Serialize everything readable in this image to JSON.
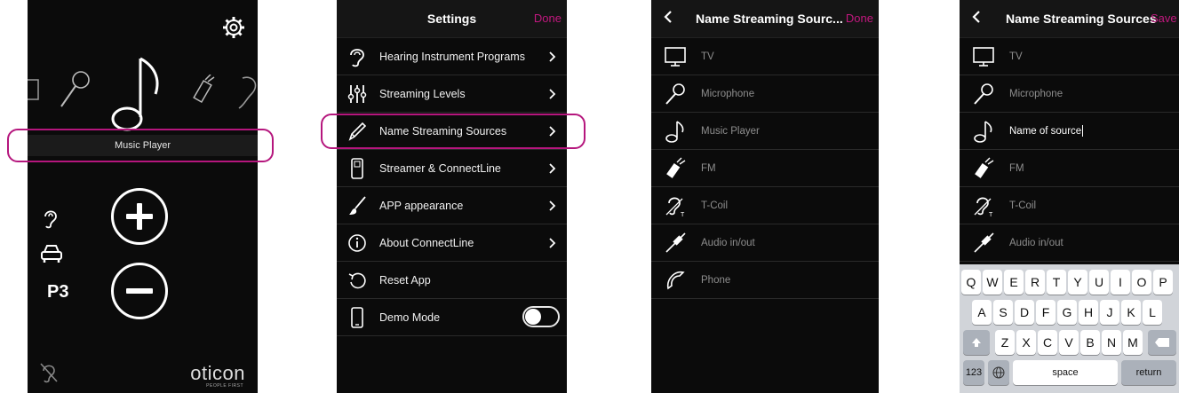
{
  "screen1": {
    "selected_source": "Music Player",
    "program": "P3",
    "brand": "oticon",
    "brand_tagline": "PEOPLE FIRST"
  },
  "settings": {
    "title": "Settings",
    "done": "Done",
    "items": [
      {
        "label": "Hearing Instrument Programs",
        "icon": "ear-icon"
      },
      {
        "label": "Streaming Levels",
        "icon": "sliders-icon"
      },
      {
        "label": "Name Streaming Sources",
        "icon": "pencil-icon"
      },
      {
        "label": "Streamer & ConnectLine",
        "icon": "streamer-icon"
      },
      {
        "label": "APP appearance",
        "icon": "brush-icon"
      },
      {
        "label": "About ConnectLine",
        "icon": "info-icon"
      },
      {
        "label": "Reset App",
        "icon": "reset-icon"
      },
      {
        "label": "Demo Mode",
        "icon": "phone-device-icon"
      }
    ]
  },
  "sources": {
    "title": "Name Streaming Sourc...",
    "done": "Done",
    "items": [
      "TV",
      "Microphone",
      "Music Player",
      "FM",
      "T-Coil",
      "Audio in/out",
      "Phone"
    ]
  },
  "edit": {
    "title": "Name Streaming Sources",
    "save": "Save",
    "items": [
      "TV",
      "Microphone",
      "Name of source",
      "FM",
      "T-Coil",
      "Audio in/out"
    ]
  },
  "keyboard": {
    "row1": [
      "Q",
      "W",
      "E",
      "R",
      "T",
      "Y",
      "U",
      "I",
      "O",
      "P"
    ],
    "row2": [
      "A",
      "S",
      "D",
      "F",
      "G",
      "H",
      "J",
      "K",
      "L"
    ],
    "row3": [
      "Z",
      "X",
      "C",
      "V",
      "B",
      "N",
      "M"
    ],
    "numbers_key": "123",
    "space_key": "space",
    "return_key": "return"
  },
  "colors": {
    "accent": "#c2187f",
    "highlight": "#b5167d",
    "background": "#0b0b0b"
  }
}
